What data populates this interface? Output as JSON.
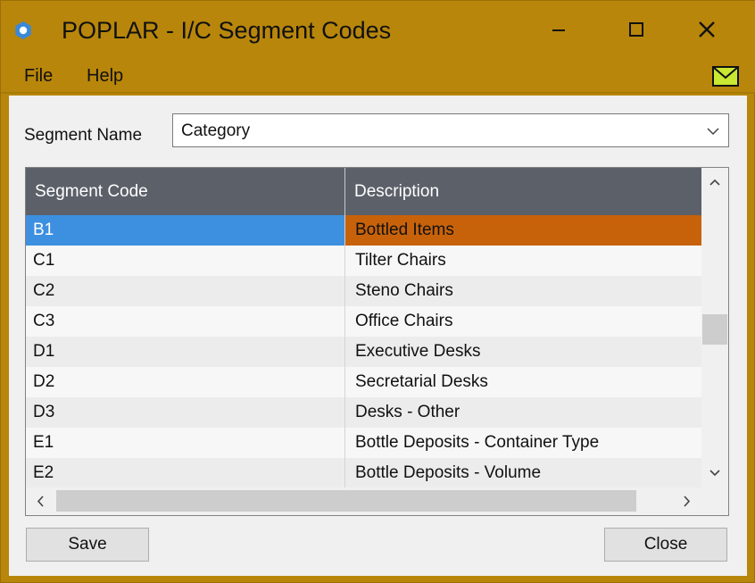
{
  "window": {
    "title": "POPLAR - I/C Segment Codes",
    "colors": {
      "title_bar": "#b8860b",
      "header": "#5b6069",
      "selected_code": "#3d8fe0",
      "selected_desc": "#c8620a"
    }
  },
  "menu": {
    "file_label": "File",
    "help_label": "Help",
    "mail_icon": "envelope-icon"
  },
  "segment": {
    "label": "Segment Name",
    "selected_value": "Category"
  },
  "table": {
    "columns": [
      "Segment Code",
      "Description"
    ],
    "selected_row": 0,
    "rows": [
      {
        "code": "B1",
        "description": "Bottled Items"
      },
      {
        "code": "C1",
        "description": "Tilter Chairs"
      },
      {
        "code": "C2",
        "description": "Steno Chairs"
      },
      {
        "code": "C3",
        "description": "Office Chairs"
      },
      {
        "code": "D1",
        "description": "Executive Desks"
      },
      {
        "code": "D2",
        "description": "Secretarial Desks"
      },
      {
        "code": "D3",
        "description": "Desks - Other"
      },
      {
        "code": "E1",
        "description": "Bottle Deposits - Container Type"
      },
      {
        "code": "E2",
        "description": "Bottle Deposits - Volume"
      }
    ]
  },
  "buttons": {
    "save_label": "Save",
    "close_label": "Close"
  }
}
